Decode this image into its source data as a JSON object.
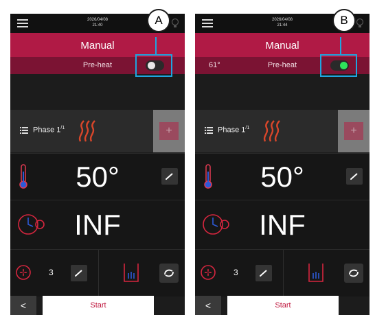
{
  "panels": [
    {
      "id": "A",
      "datetime": "2026/04/08\n21:40",
      "mode_title": "Manual",
      "temp_readout": "",
      "preheat_label": "Pre-heat",
      "preheat_toggle": "off",
      "phase_label": "Phase 1",
      "phase_sup": "/1",
      "add_label": "+",
      "temperature": "50°",
      "time": "INF",
      "fan_speed": "3",
      "back_label": "<",
      "start_label": "Start"
    },
    {
      "id": "B",
      "datetime": "2026/04/08\n21:44",
      "mode_title": "Manual",
      "temp_readout": "61°",
      "preheat_label": "Pre-heat",
      "preheat_toggle": "on",
      "phase_label": "Phase 1",
      "phase_sup": "/1",
      "add_label": "+",
      "temperature": "50°",
      "time": "INF",
      "fan_speed": "3",
      "back_label": "<",
      "start_label": "Start"
    }
  ],
  "colors": {
    "accent": "#b01a45",
    "accent_dark": "#7b1333",
    "callout": "#1ea6e0",
    "toggle_on": "#2ee35b",
    "background": "#1c1c1c"
  },
  "icons": [
    "menu-icon",
    "lightbulb-icon",
    "list-icon",
    "heat-waves-icon",
    "thermometer-icon",
    "edit-icon",
    "timer-icon",
    "fan-icon",
    "steam-icon",
    "cycle-icon"
  ]
}
